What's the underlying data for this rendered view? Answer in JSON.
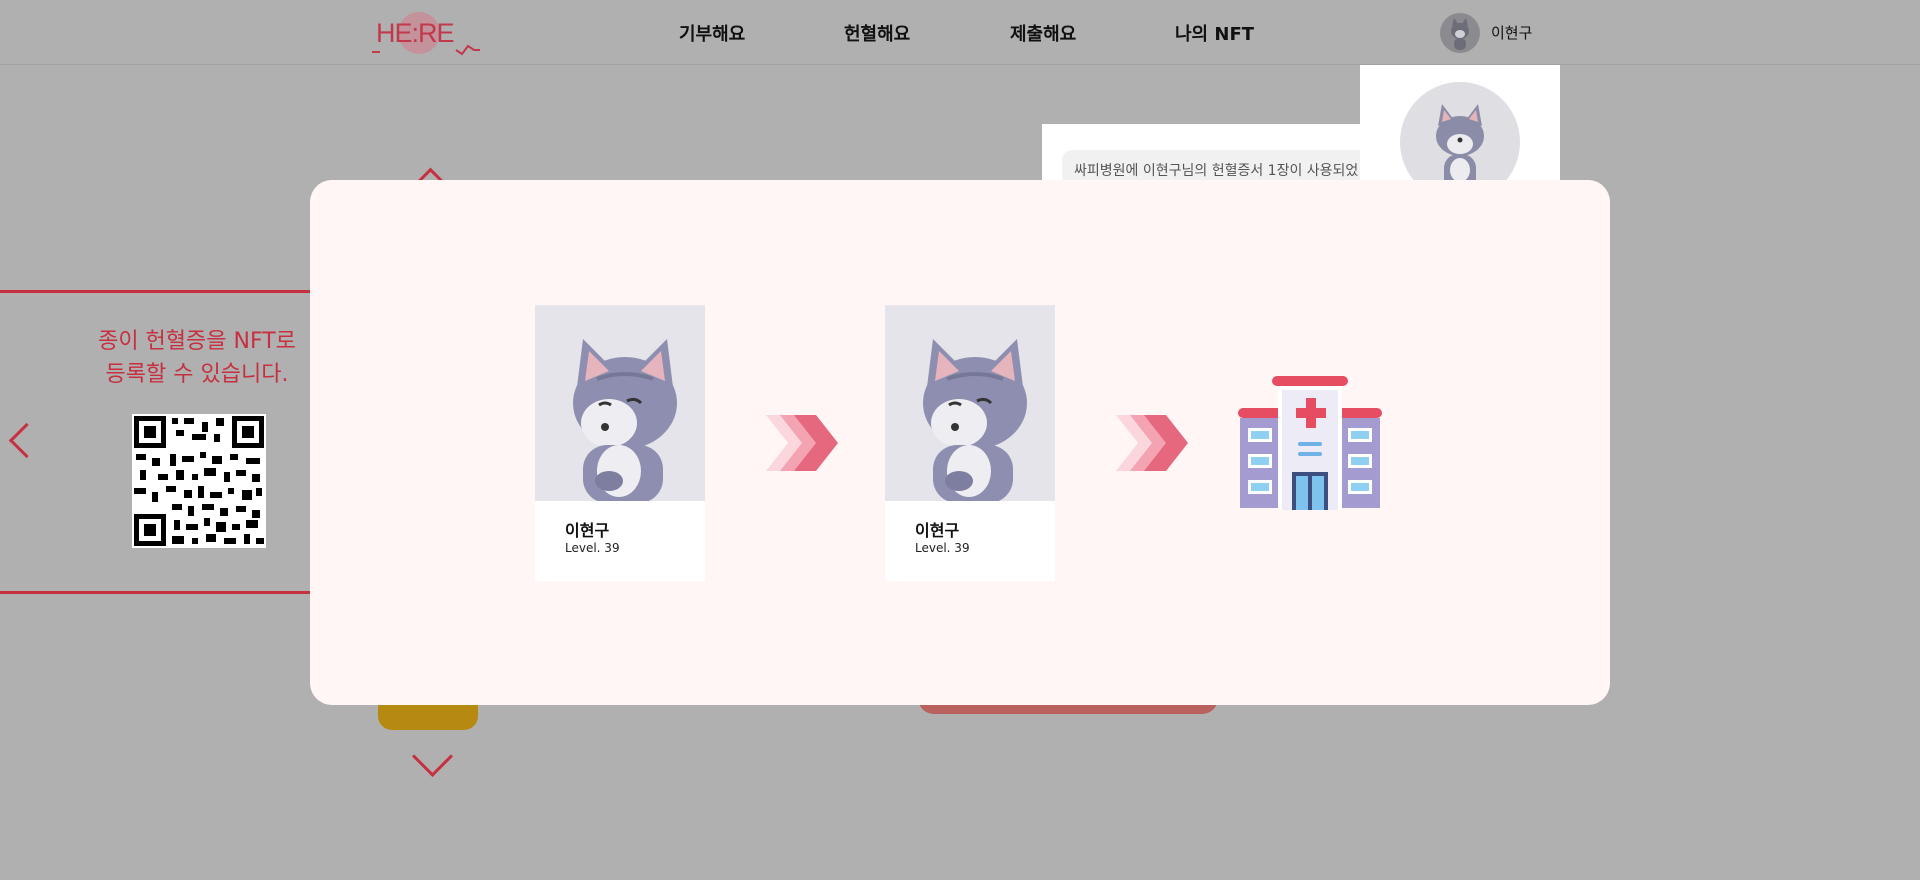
{
  "header": {
    "logo": "HE:RE",
    "nav": [
      "기부해요",
      "헌혈해요",
      "제출해요",
      "나의 NFT"
    ],
    "user_name": "이현구"
  },
  "background": {
    "side_text_line1": "종이 헌혈증을 NFT로",
    "side_text_line2": "등록할 수 있습니다.",
    "notification_text": "싸피병원에 이현구님의 헌혈증서 1장이 사용되었"
  },
  "modal": {
    "cards": [
      {
        "name": "이현구",
        "level": "Level. 39"
      },
      {
        "name": "이현구",
        "level": "Level. 39"
      }
    ]
  },
  "colors": {
    "brand_red": "#c63040",
    "modal_bg": "#fff6f5",
    "overlay": "#b0b0b0"
  }
}
